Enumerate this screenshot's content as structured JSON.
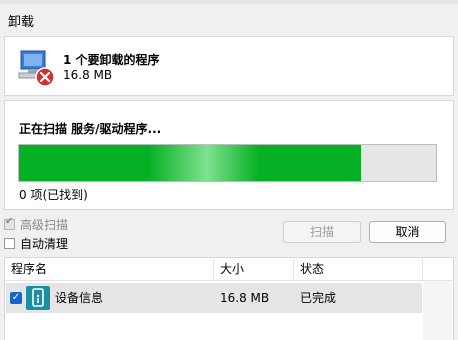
{
  "window": {
    "title": "卸载"
  },
  "summary": {
    "count_text": "1 个要卸载的程序",
    "size_text": "16.8 MB"
  },
  "scan": {
    "status_text": "正在扫描 服务/驱动程序...",
    "progress_fraction": 0.82,
    "found_text": "0 项(已找到)"
  },
  "options": {
    "advanced_scan": {
      "label": "高级扫描",
      "checked": true,
      "disabled": true
    },
    "auto_clean": {
      "label": "自动清理",
      "checked": false,
      "disabled": false
    }
  },
  "buttons": {
    "scan_label": "扫描",
    "cancel_label": "取消"
  },
  "table": {
    "columns": [
      "程序名",
      "大小",
      "状态"
    ],
    "rows": [
      {
        "name": "设备信息",
        "size": "16.8 MB",
        "status": "已完成",
        "checked": true
      }
    ]
  },
  "icons": {
    "program_icon": "uninstall-program-icon",
    "app_icon": "device-info-app-icon"
  },
  "colors": {
    "progress_green": "#06b025",
    "app_icon_teal": "#1a8fa0",
    "checkbox_blue": "#1567c7"
  }
}
